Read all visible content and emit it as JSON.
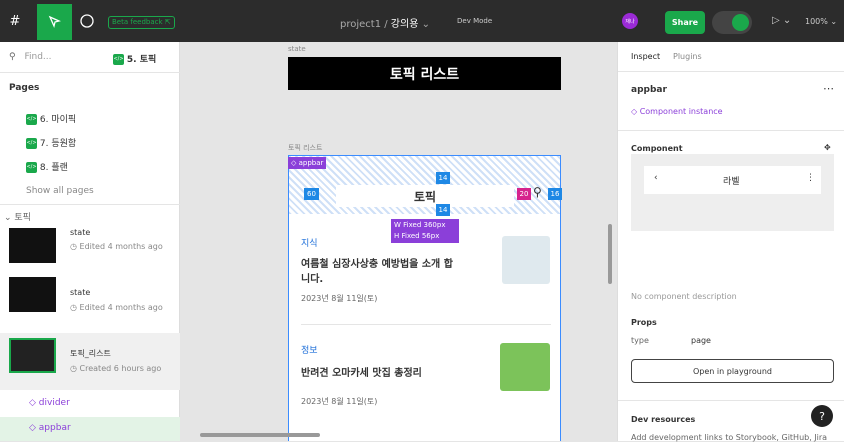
{
  "topbar": {
    "beta": "Beta feedback ⇱",
    "project": "project1 / ",
    "file": "강의용",
    "chev": "⌄",
    "devmode": "Dev Mode",
    "avatar": "재나",
    "share": "Share",
    "zoom": "100% ⌄",
    "play": "▷ ⌄"
  },
  "left": {
    "find": "Find...",
    "page_tag": "5. 토픽",
    "pages_title": "Pages",
    "pages": [
      "6. 마이픽",
      "7. 등원함",
      "8. 플랜"
    ],
    "show_all": "Show all pages",
    "section": "토픽",
    "layers": [
      {
        "name": "state",
        "sub": "Edited 4 months ago"
      },
      {
        "name": "state",
        "sub": "Edited 4 months ago"
      },
      {
        "name": "토픽_리스트",
        "sub": "Created 6 hours ago"
      }
    ],
    "children": [
      "divider",
      "appbar"
    ]
  },
  "canvas": {
    "state_label": "state",
    "state_title": "토픽 리스트",
    "frame_label": "토픽 리스트",
    "appbar_label": "appbar",
    "appbar_title": "토픽",
    "spacing": {
      "top": "14",
      "bottom": "14",
      "left": "60",
      "right": "16",
      "gap": "20"
    },
    "size_w": "W Fixed 360px",
    "size_h": "H Fixed 56px",
    "cards": [
      {
        "cat": "지식",
        "title": "여름철 심장사상충 예방법을 소개 합니다.",
        "date": "2023년 8월 11일(토)"
      },
      {
        "cat": "정보",
        "title": "반려견 오마카세 맛집 총정리",
        "date": "2023년 8월 11일(토)"
      }
    ]
  },
  "right": {
    "tab_inspect": "Inspect",
    "tab_plugins": "Plugins",
    "name": "appbar",
    "instance": "Component instance",
    "component": "Component",
    "preview_title": "라벨",
    "no_desc": "No component description",
    "props": "Props",
    "prop_key": "type",
    "prop_val": "page",
    "open_playground": "Open in playground",
    "dev_resources": "Dev resources",
    "dev_link": "Add development links to Storybook, GitHub, Jira"
  },
  "help": "?"
}
